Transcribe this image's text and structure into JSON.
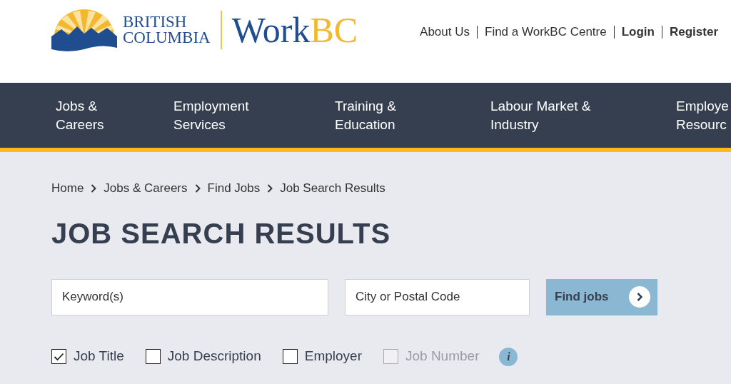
{
  "logo": {
    "province_lines": [
      "BRITISH",
      "COLUMBIA"
    ],
    "brand": "Work",
    "brand_accent": "BC"
  },
  "top_links": [
    {
      "label": "About Us",
      "bold": false
    },
    {
      "label": "Find a WorkBC Centre",
      "bold": false
    },
    {
      "label": "Login",
      "bold": true
    },
    {
      "label": "Register",
      "bold": true
    }
  ],
  "nav": [
    {
      "lines": [
        "Jobs &",
        "Careers"
      ]
    },
    {
      "lines": [
        "Employment",
        "Services"
      ]
    },
    {
      "lines": [
        "Training &",
        "Education"
      ]
    },
    {
      "lines": [
        "Labour Market &",
        "Industry"
      ]
    },
    {
      "lines": [
        "Employe",
        "Resourc"
      ]
    }
  ],
  "breadcrumb": [
    "Home",
    "Jobs & Careers",
    "Find Jobs",
    "Job Search Results"
  ],
  "title": "JOB SEARCH RESULTS",
  "search": {
    "keyword_placeholder": "Keyword(s)",
    "location_placeholder": "City or Postal Code",
    "button": "Find jobs"
  },
  "filters": [
    {
      "label": "Job Title",
      "checked": true,
      "disabled": false
    },
    {
      "label": "Job Description",
      "checked": false,
      "disabled": false
    },
    {
      "label": "Employer",
      "checked": false,
      "disabled": false
    },
    {
      "label": "Job Number",
      "checked": false,
      "disabled": true
    }
  ],
  "info_glyph": "i"
}
